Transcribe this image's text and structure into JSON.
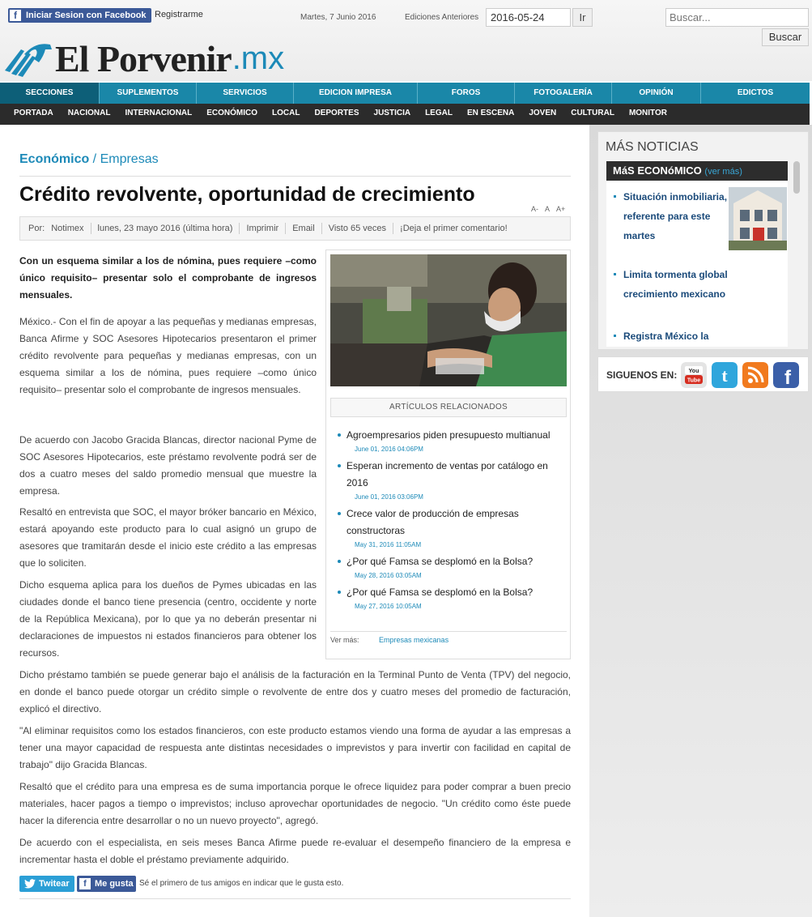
{
  "topbar": {
    "facebook_login": "Iniciar Sesion con Facebook",
    "register": "Registrarme",
    "date": "Martes, 7 Junio 2016",
    "previous_editions_label": "Ediciones Anteriores",
    "edition_value": "2016-05-24",
    "go_label": "Ir",
    "search_placeholder": "Buscar...",
    "search_button": "Buscar"
  },
  "logo": {
    "name": "El Porvenir",
    "tld": ".mx"
  },
  "nav_primary": [
    "SECCIONES",
    "SUPLEMENTOS",
    "SERVICIOS",
    "EDICION IMPRESA",
    "FOROS",
    "FOTOGALERÍA",
    "OPINIÓN",
    "EDICTOS"
  ],
  "nav_secondary": [
    "PORTADA",
    "NACIONAL",
    "INTERNACIONAL",
    "ECONÓMICO",
    "LOCAL",
    "DEPORTES",
    "JUSTICIA",
    "LEGAL",
    "EN ESCENA",
    "JOVEN",
    "CULTURAL",
    "MONITOR"
  ],
  "breadcrumb": {
    "section": "Económico",
    "separator": " / ",
    "subsection": "Empresas"
  },
  "article": {
    "title": "Crédito revolvente, oportunidad de crecimiento",
    "font_tools": [
      "A-",
      "A",
      "A+"
    ],
    "meta": {
      "by_label": "Por:",
      "author": "Notimex",
      "date": "lunes, 23 mayo 2016 (última hora)",
      "print": "Imprimir",
      "email": "Email",
      "views": "Visto 65 veces",
      "comment": "¡Deja el primer comentario!"
    },
    "lead": "Con un esquema similar a los de nómina, pues requiere –como único requisito– presentar solo el comprobante de ingresos mensuales.",
    "paragraphs": [
      "México.- Con el fin de apoyar a las pequeñas y medianas empresas, Banca Afirme y SOC Asesores Hipotecarios presentaron el primer crédito revolvente para pequeñas y medianas empresas, con un esquema similar a los de nómina, pues requiere –como único requisito– presentar solo el comprobante de ingresos mensuales.",
      "De acuerdo con Jacobo Gracida Blancas, director nacional Pyme de SOC Asesores Hipotecarios, este préstamo revolvente podrá ser de dos a cuatro meses del saldo promedio mensual que muestre la empresa.",
      "Resaltó en entrevista que SOC, el mayor bróker bancario en México, estará apoyando este producto para lo cual asignó un grupo de asesores que tramitarán desde el inicio este crédito a las empresas que lo soliciten.",
      "Dicho esquema aplica para los dueños de Pymes ubicadas en las ciudades donde el banco tiene presencia (centro, occidente y norte de la República Mexicana), por lo que ya no deberán presentar ni declaraciones de impuestos ni estados financieros para obtener los recursos.",
      "Dicho préstamo también se puede generar bajo el análisis de la facturación en la Terminal Punto de Venta (TPV) del negocio, en donde el banco puede otorgar un crédito simple o revolvente de entre dos y cuatro meses del promedio de facturación, explicó el directivo.",
      "\"Al eliminar requisitos como los estados financieros, con este producto estamos viendo una forma de ayudar a las empresas a tener una mayor capacidad de respuesta ante distintas necesidades o imprevistos y para invertir con facilidad en capital de trabajo\" dijo Gracida Blancas.",
      "Resaltó que el crédito para una empresa es de suma importancia porque le ofrece liquidez para poder comprar a buen precio materiales, hacer pagos a tiempo o imprevistos; incluso aprovechar oportunidades de negocio. \"Un crédito como éste puede hacer la diferencia entre desarrollar o no un nuevo proyecto\", agregó.",
      "De acuerdo con el especialista, en seis meses Banca Afirme puede re-evaluar el desempeño financiero de la empresa e incrementar hasta el doble el préstamo previamente adquirido."
    ]
  },
  "related": {
    "title": "ARTÍCULOS RELACIONADOS",
    "items": [
      {
        "title": "Agroempresarios piden presupuesto multianual",
        "date": "June 01, 2016 04:06PM"
      },
      {
        "title": "Esperan incremento de ventas por catálogo en 2016",
        "date": "June 01, 2016 03:06PM"
      },
      {
        "title": "Crece valor de producción de empresas constructoras",
        "date": "May 31, 2016 11:05AM"
      },
      {
        "title": "¿Por qué Famsa se desplomó en la Bolsa?",
        "date": "May 28, 2016 03:05AM"
      },
      {
        "title": "¿Por qué Famsa se desplomó en la Bolsa?",
        "date": "May 27, 2016 10:05AM"
      }
    ],
    "see_more_label": "Ver más:",
    "see_more_link": "Empresas mexicanas"
  },
  "social_bottom": {
    "tweet": "Twitear",
    "like": "Me gusta",
    "like_text": "Sé el primero de tus amigos en indicar que le gusta esto."
  },
  "sidebar": {
    "more_news_title": "MÁS NOTICIAS",
    "section_title": "MáS ECONóMICO",
    "see_more": "(ver más)",
    "news": [
      "Situación inmobiliaria, referente para este martes",
      "Limita tormenta global crecimiento mexicano",
      "Registra México la"
    ],
    "follow_label": "SIGUENOS EN:",
    "social_icons": [
      "youtube-icon",
      "twitter-icon",
      "rss-icon",
      "facebook-icon"
    ]
  },
  "colors": {
    "accent": "#1d8ab8",
    "nav_primary": "#1a87a8",
    "nav_secondary": "#2b2b2b",
    "facebook": "#3b5998",
    "twitter": "#2b9fd6"
  }
}
